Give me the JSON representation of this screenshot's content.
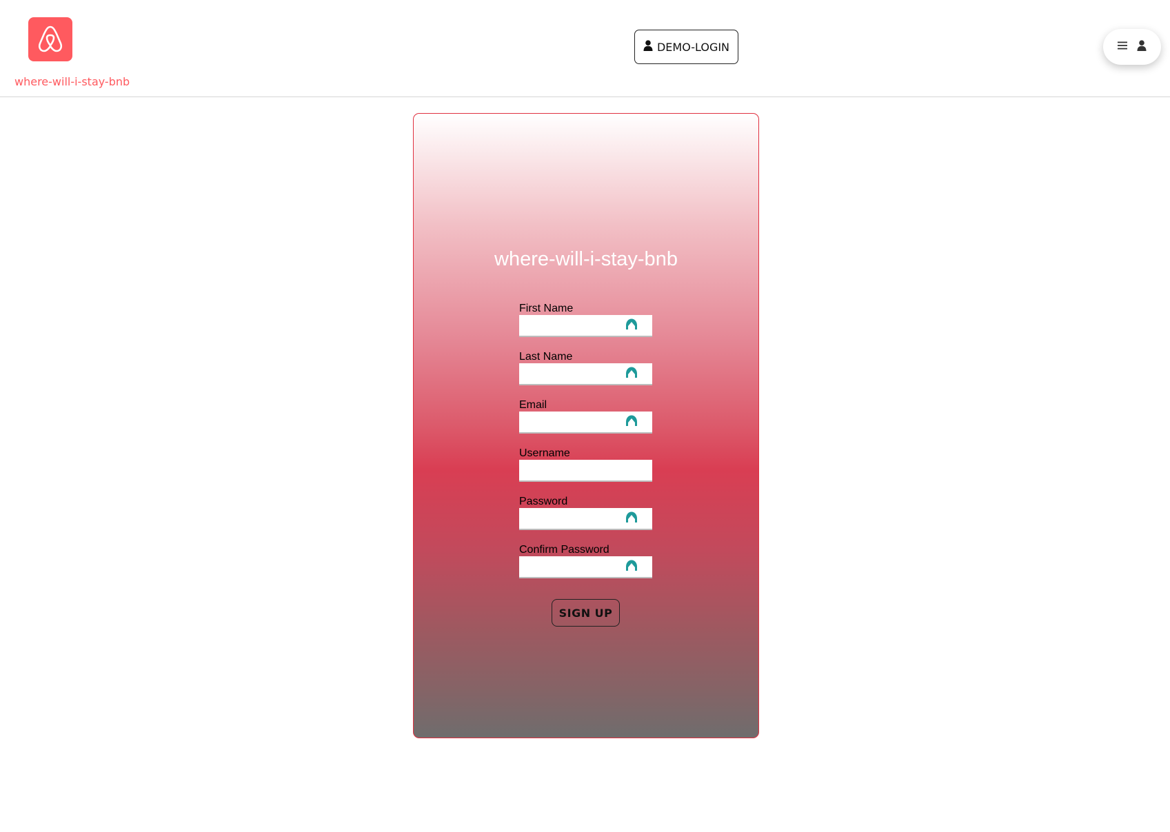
{
  "header": {
    "logo_text": "where-will-i-stay-bnb",
    "logo_icon": "airbnb-logo-icon",
    "demo_login_label": "DEMO-LOGIN",
    "menu_icons": [
      "menu-icon",
      "user-icon"
    ]
  },
  "signup_form": {
    "title": "where-will-i-stay-bnb",
    "fields": [
      {
        "label": "First Name",
        "value": "",
        "has_autofill_icon": true
      },
      {
        "label": "Last Name",
        "value": "",
        "has_autofill_icon": true
      },
      {
        "label": "Email",
        "value": "",
        "has_autofill_icon": true
      },
      {
        "label": "Username",
        "value": "",
        "has_autofill_icon": false
      },
      {
        "label": "Password",
        "value": "",
        "has_autofill_icon": true
      },
      {
        "label": "Confirm Password",
        "value": "",
        "has_autofill_icon": true
      }
    ],
    "submit_label": "SIGN UP"
  },
  "colors": {
    "brand": "#ff5a5f",
    "card_border": "#e0303f",
    "autofill_icon": "#1e9a9a"
  }
}
